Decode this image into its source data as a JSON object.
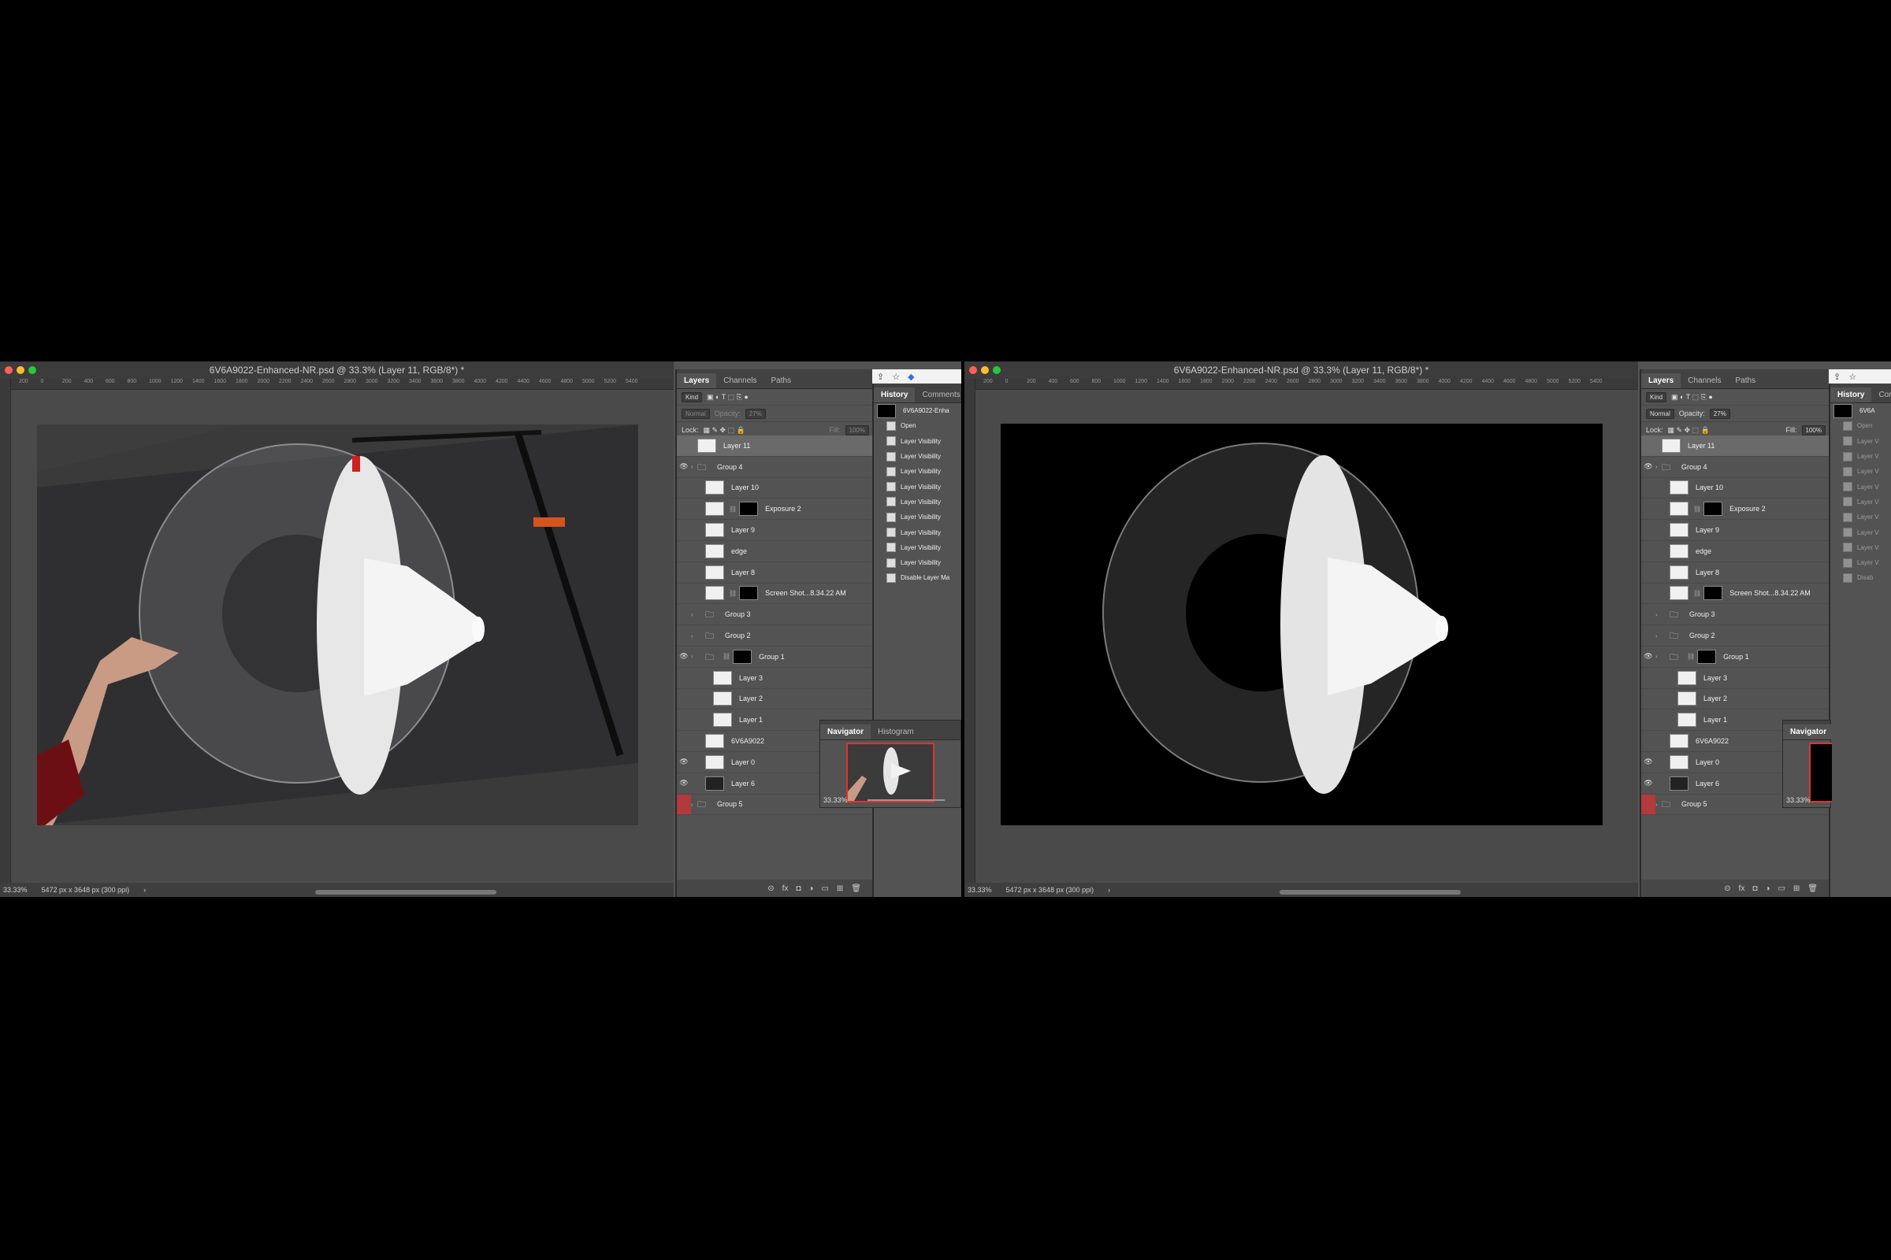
{
  "window_title": "6V6A9022-Enhanced-NR.psd @ 33.3% (Layer 11, RGB/8*) *",
  "ruler_ticks": [
    "200",
    "0",
    "200",
    "400",
    "600",
    "800",
    "1000",
    "1200",
    "1400",
    "1600",
    "1800",
    "2000",
    "2200",
    "2400",
    "2600",
    "2800",
    "3000",
    "3200",
    "3400",
    "3600",
    "3800",
    "4000",
    "4200",
    "4400",
    "4600",
    "4800",
    "5000",
    "5200",
    "5400"
  ],
  "status": {
    "zoom": "33.33%",
    "doc_info": "5472 px x 3648 px (300 ppi)",
    "arrow": "›"
  },
  "layers_panel": {
    "tabs": [
      "Layers",
      "Channels",
      "Paths"
    ],
    "kind": "Kind",
    "blend_mode": "Normal",
    "opacity_label": "Opacity:",
    "opacity_left": "27%",
    "opacity_right": "27%",
    "lock_label": "Lock:",
    "fill_label": "Fill:",
    "fill_value": "100%",
    "layers": [
      {
        "name": "Layer 11",
        "visible": false,
        "selected": true,
        "indent": 0
      },
      {
        "name": "Group 4",
        "visible": true,
        "folder": true,
        "indent": 0
      },
      {
        "name": "Layer 10",
        "visible": false,
        "indent": 1
      },
      {
        "name": "Exposure 2",
        "visible": false,
        "indent": 1,
        "mask": true
      },
      {
        "name": "Layer 9",
        "visible": false,
        "indent": 1
      },
      {
        "name": "edge",
        "visible": false,
        "indent": 1
      },
      {
        "name": "Layer 8",
        "visible": false,
        "indent": 1
      },
      {
        "name": "Screen Shot...8.34.22 AM",
        "visible": false,
        "indent": 1,
        "mask": true
      },
      {
        "name": "Group 3",
        "visible": false,
        "folder": true,
        "indent": 1
      },
      {
        "name": "Group 2",
        "visible": false,
        "folder": true,
        "indent": 1
      },
      {
        "name": "Group 1",
        "visible": true,
        "folder": true,
        "indent": 1,
        "mask": true
      },
      {
        "name": "Layer 3",
        "visible": false,
        "indent": 2
      },
      {
        "name": "Layer 2",
        "visible": false,
        "indent": 2
      },
      {
        "name": "Layer 1",
        "visible": false,
        "indent": 2
      },
      {
        "name": "6V6A9022",
        "visible": false,
        "indent": 1
      },
      {
        "name": "Layer 0",
        "visible": true,
        "indent": 1
      },
      {
        "name": "Layer 6",
        "visible": true,
        "indent": 1
      },
      {
        "name": "Group 5",
        "visible": false,
        "folder": true,
        "indent": 0,
        "red": true
      }
    ]
  },
  "history_panel": {
    "tabs": [
      "History",
      "Comments"
    ],
    "snapshot": "6V6A9022-Enha",
    "items": [
      "Open",
      "Layer Visibility",
      "Layer Visibility",
      "Layer Visibility",
      "Layer Visibility",
      "Layer Visibility",
      "Layer Visibility",
      "Layer Visibility",
      "Layer Visibility",
      "Layer Visibility",
      "Disable Layer Ma"
    ]
  },
  "history_panel_right": {
    "tabs": [
      "History",
      "Comm"
    ],
    "snapshot": "6V6A",
    "items": [
      "Open",
      "Layer V",
      "Layer V",
      "Layer V",
      "Layer V",
      "Layer V",
      "Layer V",
      "Layer V",
      "Layer V",
      "Layer V",
      "Disab"
    ]
  },
  "navigator": {
    "tabs": [
      "Navigator",
      "Histogram"
    ],
    "zoom": "33.33%"
  },
  "navigator_right": {
    "tabs": [
      "Navigator"
    ],
    "zoom": "33.33%"
  }
}
